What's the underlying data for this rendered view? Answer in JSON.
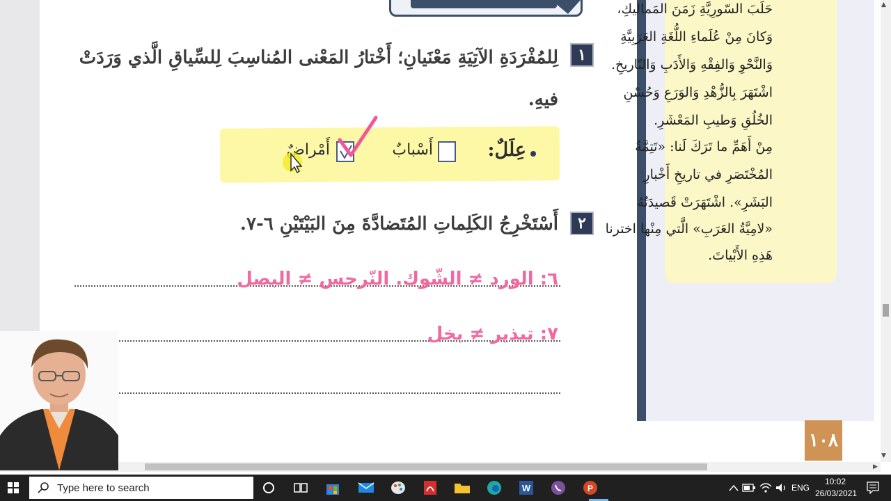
{
  "document": {
    "top_tab_label": "",
    "question1": {
      "number": "١",
      "line1": "لِلمُفْرَدَةِ الآتِيَةِ مَعْنَيانِ؛ أَخْتارُ المَعْنى المُناسِبَ لِلسِّياقِ الَّذي وَرَدَتْ",
      "line2": "فيهِ.",
      "word": "عِلَلٌ:",
      "option_a": "أَسْبابٌ",
      "option_b": "أَمْراضٌ",
      "checked_option": "option_b"
    },
    "question2": {
      "number": "٢",
      "text": "أَسْتَخْرِجُ الكَلِماتِ المُتَضادَّةَ مِنَ البَيْتَيْنِ ٦-٧.",
      "answer1": "٦: الورد ≠ الشّوك. النّرجس ≠ البصل",
      "answer2": "٧: تبذير ≠ بخل"
    },
    "sidebar": {
      "lines": [
        "حَلَبَ السّورِيَّةِ زَمَنَ المَماليكِ،",
        "وَكانَ مِنْ عُلَماءِ اللُّغَةِ العَرَبِيَّةِ",
        "وَالنَّحْوِ وَالفِقْهِ وَالأَدَبِ وَالتّاريخِ.",
        "اشْتَهَرَ بِالزُّهْدِ وَالوَرَعِ وَحُسْنِ",
        "الخُلُقِ وَطيبِ المَعْشَرِ.",
        "مِنْ أَهَمِّ ما تَرَكَ لَنا: «تَتِمَّةُ",
        "المُخْتَصَرِ في تاريخِ أَخْبارِ",
        "البَشَرِ». اشْتَهَرَتْ قَصيدَتُهُ",
        "«لامِيَّةُ العَرَبِ» الَّتي مِنْها اخترنا",
        "هَذِهِ الأَبْياتَ."
      ]
    },
    "page_number": "١٠٨"
  },
  "taskbar": {
    "search_placeholder": "Type here to search",
    "language": "ENG",
    "time": "10:02",
    "date": "26/03/2021"
  },
  "colors": {
    "accent_navy": "#2f3a56",
    "answer_pink": "#f06aa0",
    "highlight_yellow": "#fcf8a6",
    "page_tab_orange": "#cf9455"
  }
}
